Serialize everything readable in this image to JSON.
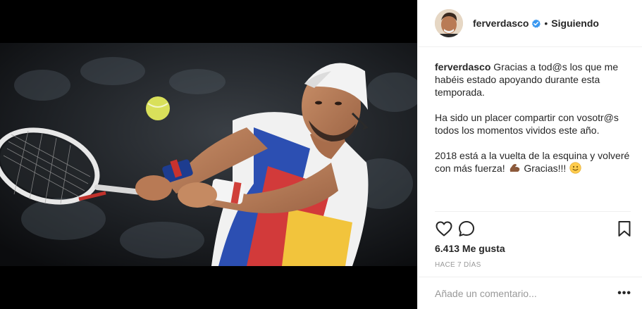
{
  "post": {
    "author": {
      "username": "ferverdasco",
      "verified": true,
      "follow_status": "Siguiendo",
      "separator": "•"
    },
    "caption": {
      "username": "ferverdasco",
      "paragraphs": [
        "Gracias a tod@s los que me habéis estado apoyando durante esta temporada.",
        "Ha sido un placer compartir con vosotr@s todos los momentos vividos este año.",
        "2018 está a la vuelta de la esquina y volveré con más fuerza!"
      ],
      "closing": "Gracias!!!",
      "emojis": [
        "flexed-biceps-emoji",
        "smiling-face-emoji"
      ]
    },
    "likes": "6.413 Me gusta",
    "timestamp": "HACE 7 DÍAS",
    "comment": {
      "placeholder": "Añade un comentario...",
      "value": ""
    },
    "more_label": "•••",
    "icons": {
      "like": "heart-outline-icon",
      "comment": "speech-bubble-icon",
      "save": "bookmark-icon",
      "verified": "verified-badge-icon"
    },
    "colors": {
      "verified": "#3897f0",
      "text": "#262626",
      "muted": "#999999",
      "border": "#efefef"
    }
  }
}
